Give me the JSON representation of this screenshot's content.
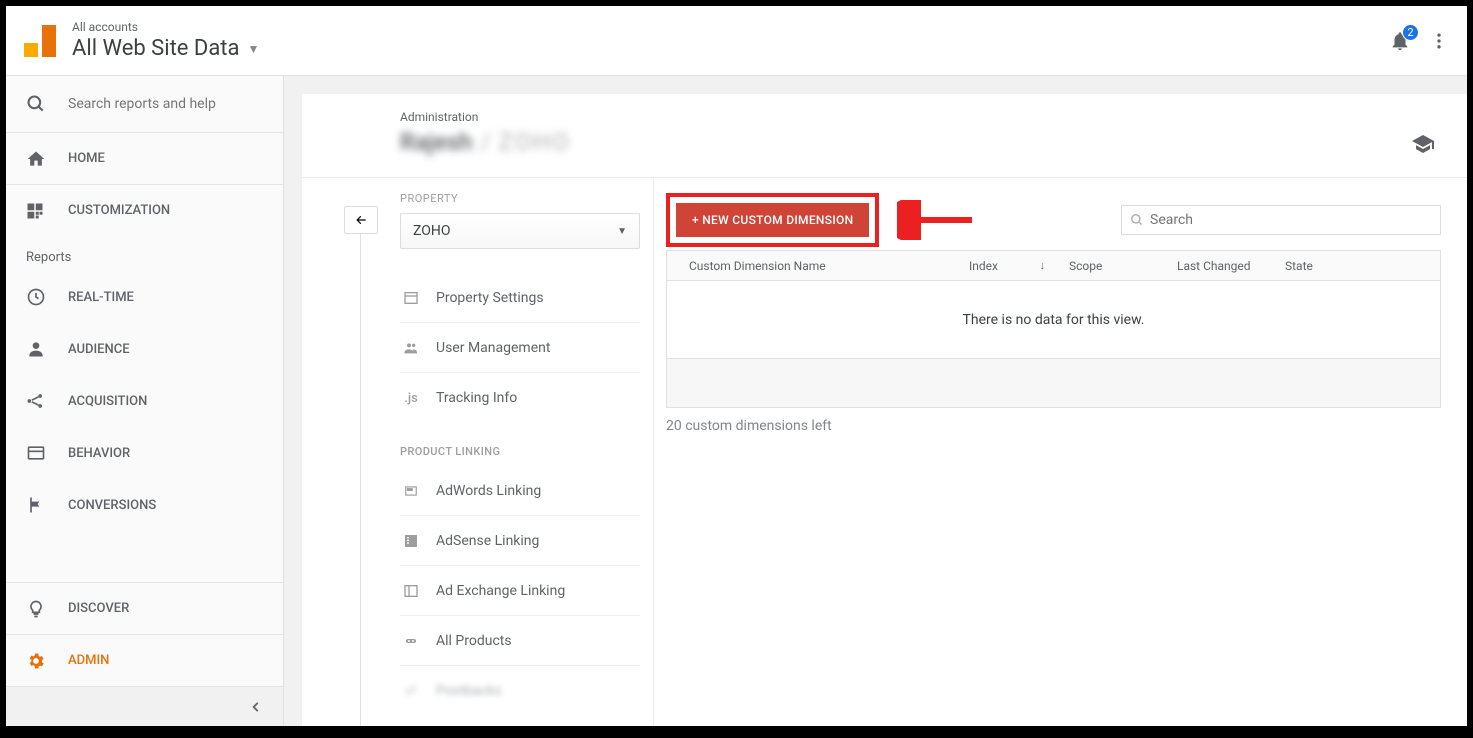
{
  "header": {
    "accounts_label": "All accounts",
    "view_title": "All Web Site Data",
    "notification_count": "2"
  },
  "sidebar": {
    "search_placeholder": "Search reports and help",
    "home": "HOME",
    "customization": "CUSTOMIZATION",
    "reports_label": "Reports",
    "realtime": "REAL-TIME",
    "audience": "AUDIENCE",
    "acquisition": "ACQUISITION",
    "behavior": "BEHAVIOR",
    "conversions": "CONVERSIONS",
    "discover": "DISCOVER",
    "admin": "ADMIN"
  },
  "admin": {
    "label": "Administration",
    "breadcrumb_account": "Rajesh",
    "breadcrumb_property": "ZOHO"
  },
  "property": {
    "label": "PROPERTY",
    "selected": "ZOHO",
    "items": {
      "settings": "Property Settings",
      "user_mgmt": "User Management",
      "tracking": "Tracking Info",
      "section_label": "PRODUCT LINKING",
      "adwords": "AdWords Linking",
      "adsense": "AdSense Linking",
      "adexchange": "Ad Exchange Linking",
      "allproducts": "All Products",
      "postbacks": "Postbacks"
    }
  },
  "main": {
    "new_button": "+ NEW CUSTOM DIMENSION",
    "search_placeholder": "Search",
    "columns": {
      "name": "Custom Dimension Name",
      "index": "Index",
      "scope": "Scope",
      "changed": "Last Changed",
      "state": "State"
    },
    "empty_message": "There is no data for this view.",
    "remaining": "20 custom dimensions left"
  }
}
